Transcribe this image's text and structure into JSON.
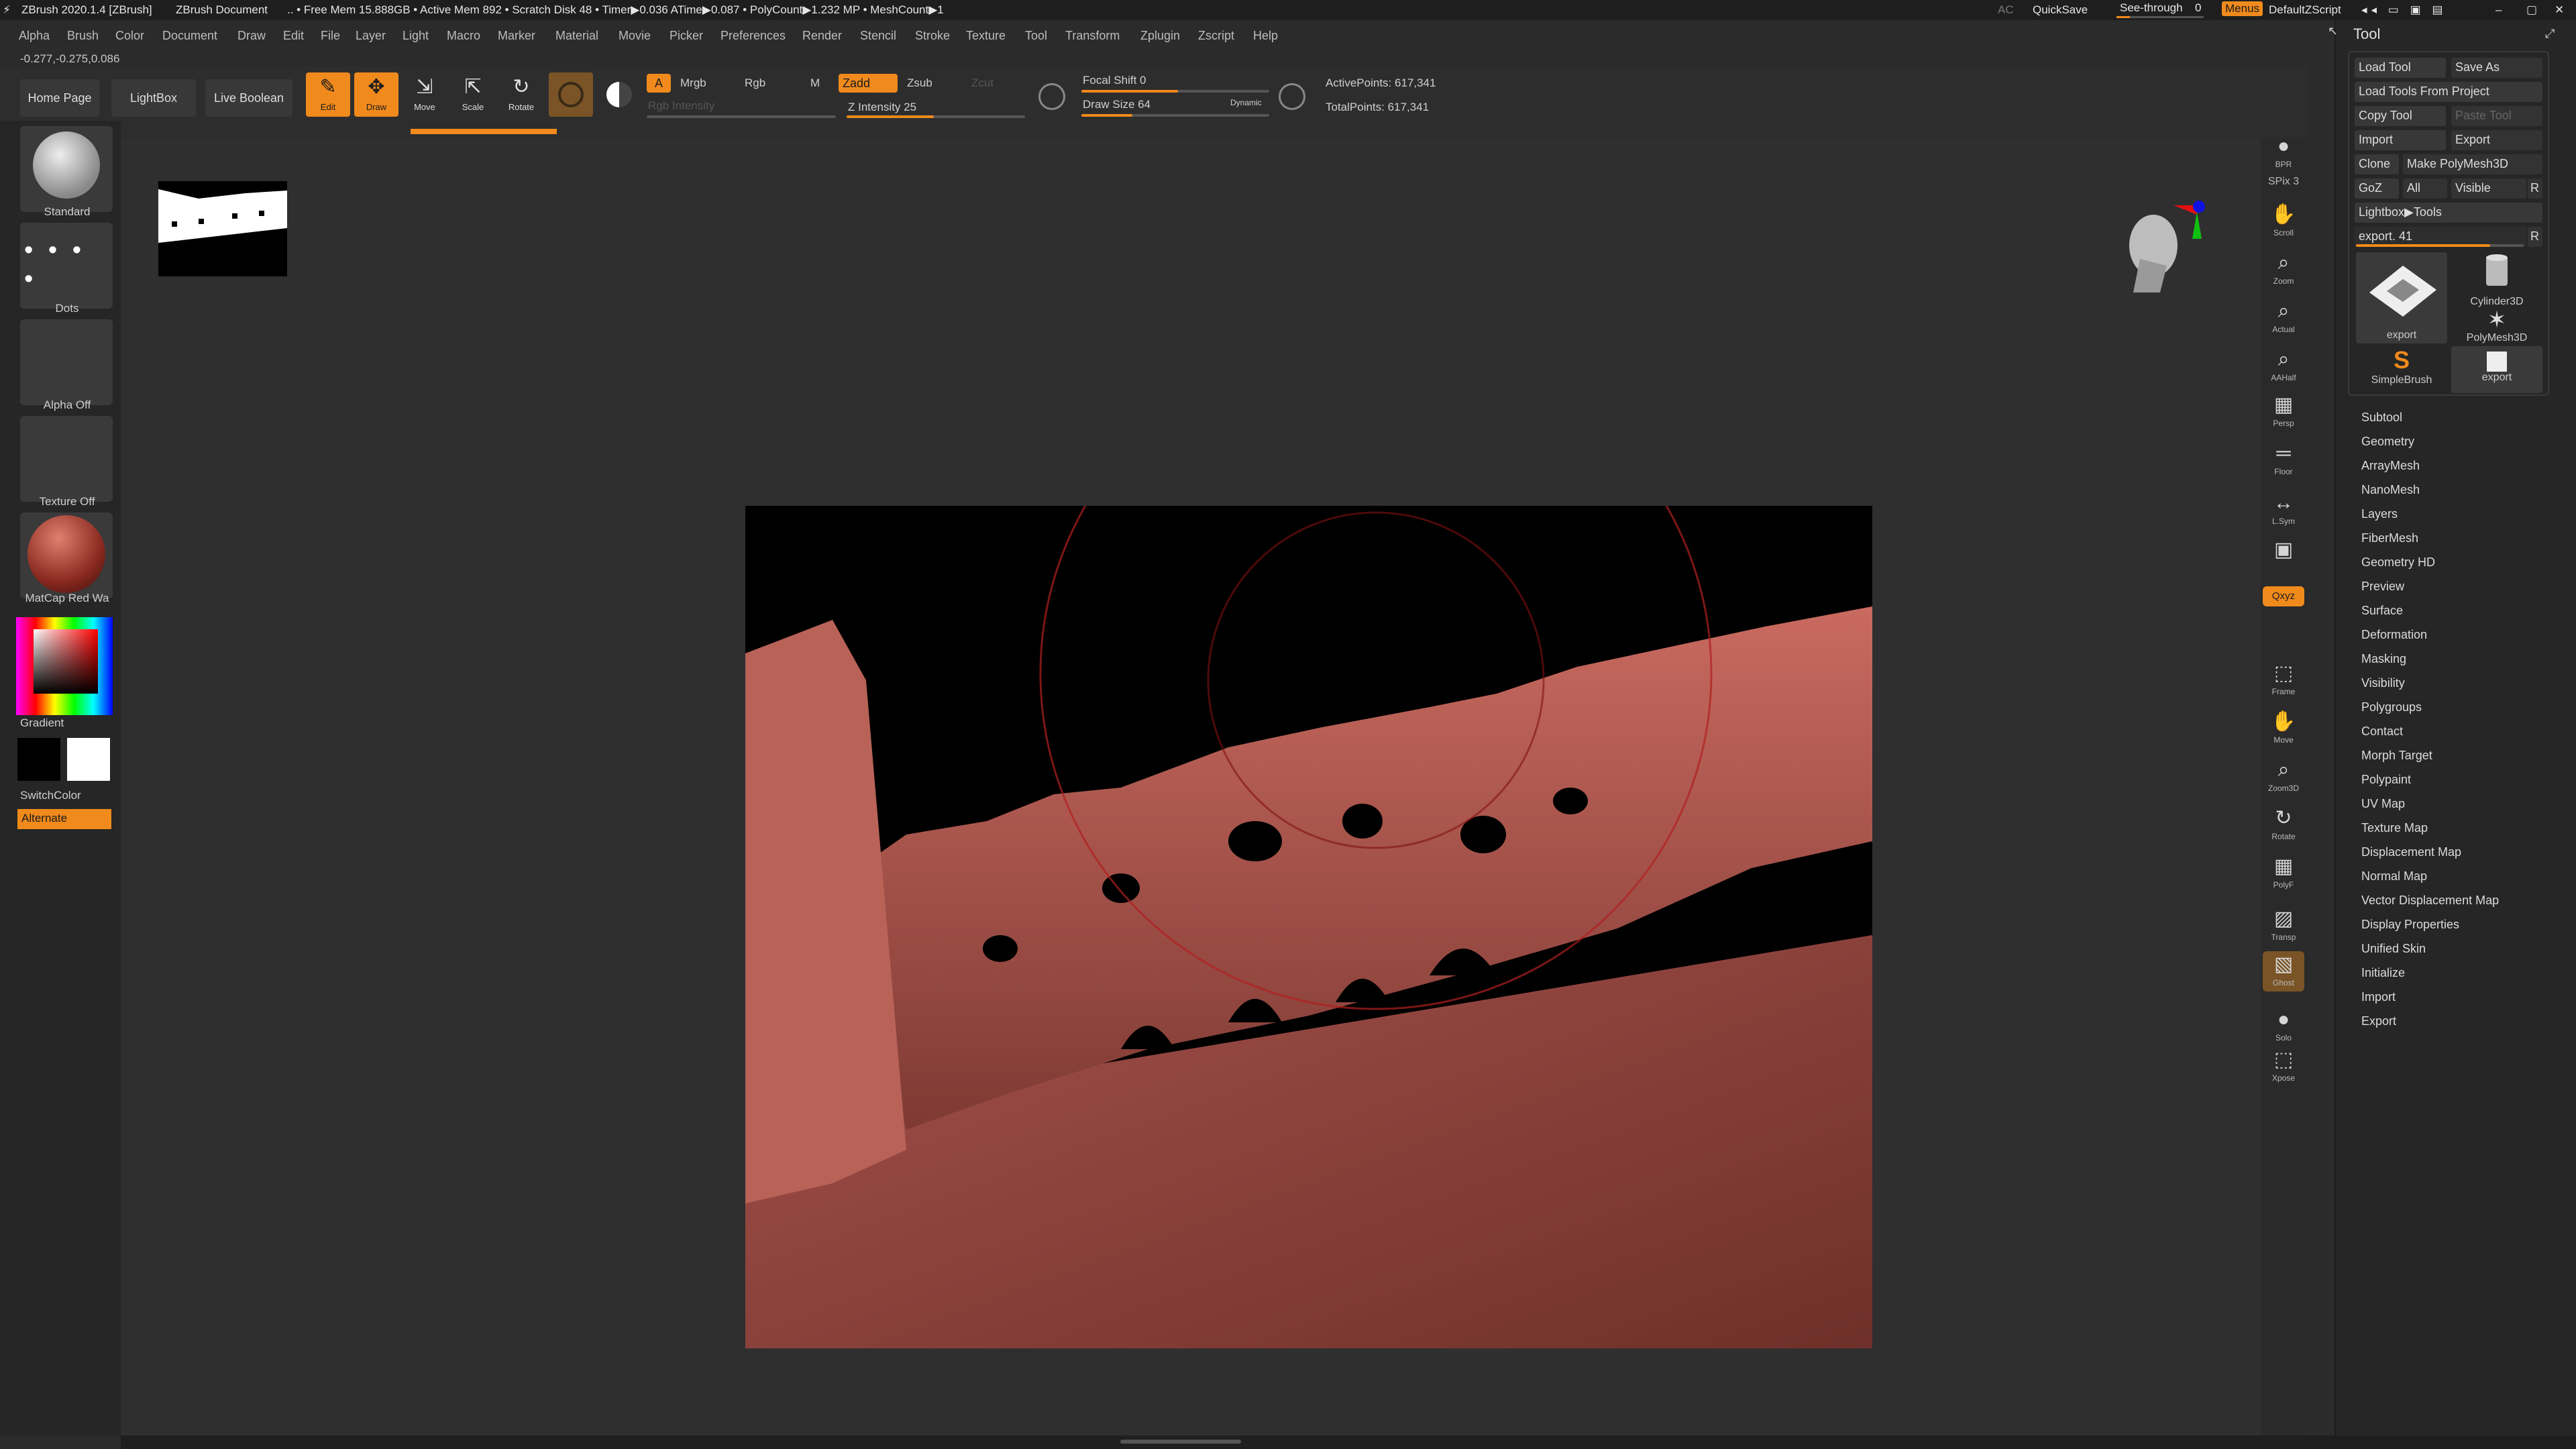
{
  "title_bar": {
    "app": "ZBrush 2020.1.4 [ZBrush]",
    "document": "ZBrush Document",
    "stats": ".. • Free Mem 15.888GB • Active Mem 892 • Scratch Disk 48 • Timer▶0.036 ATime▶0.087 • PolyCount▶1.232 MP • MeshCount▶1",
    "ac": "AC",
    "quicksave": "QuickSave",
    "see_through": "See-through",
    "see_through_value": "0",
    "menus": "Menus",
    "zscript": "DefaultZScript"
  },
  "menu_bar": [
    "Alpha",
    "Brush",
    "Color",
    "Document",
    "Draw",
    "Edit",
    "File",
    "Layer",
    "Light",
    "Macro",
    "Marker",
    "Material",
    "Movie",
    "Picker",
    "Preferences",
    "Render",
    "Stencil",
    "Stroke",
    "Texture",
    "Tool",
    "Transform",
    "Zplugin",
    "Zscript",
    "Help"
  ],
  "coords": "-0.277,-0.275,0.086",
  "top_shelf": {
    "home_page": "Home Page",
    "lightbox": "LightBox",
    "live_boolean": "Live Boolean",
    "edit": "Edit",
    "draw": "Draw",
    "move": "Move",
    "scale": "Scale",
    "rotate": "Rotate",
    "a": "A",
    "mrgb": "Mrgb",
    "rgb": "Rgb",
    "m": "M",
    "rgb_intensity": "Rgb Intensity",
    "zadd": "Zadd",
    "zsub": "Zsub",
    "zcut": "Zcut",
    "z_intensity": "Z Intensity 25",
    "focal_shift": "Focal Shift 0",
    "draw_size": "Draw Size 64",
    "dynamic": "Dynamic",
    "active_points": "ActivePoints: 617,341",
    "total_points": "TotalPoints: 617,341"
  },
  "left_panel": {
    "brush": "Standard",
    "stroke": "Dots",
    "alpha": "Alpha Off",
    "texture": "Texture Off",
    "material": "MatCap Red Wa",
    "gradient": "Gradient",
    "switch_color": "SwitchColor",
    "alternate": "Alternate"
  },
  "right_shelf": [
    {
      "name": "bpr",
      "label": "BPR",
      "glyph": "●"
    },
    {
      "name": "spix",
      "label": "SPix 3",
      "glyph": ""
    },
    {
      "name": "scroll",
      "label": "Scroll",
      "glyph": "✋"
    },
    {
      "name": "zoom",
      "label": "Zoom",
      "glyph": "⌕"
    },
    {
      "name": "actual",
      "label": "Actual",
      "glyph": "⌕"
    },
    {
      "name": "aahalf",
      "label": "AAHalf",
      "glyph": "⌕"
    },
    {
      "name": "persp",
      "label": "Persp",
      "glyph": "▦"
    },
    {
      "name": "floor",
      "label": "Floor",
      "glyph": "═"
    },
    {
      "name": "lsym",
      "label": "L.Sym",
      "glyph": "↔"
    },
    {
      "name": "lock",
      "label": "",
      "glyph": "▣"
    },
    {
      "name": "xyz",
      "label": "Qxyz",
      "glyph": ""
    },
    {
      "name": "frame",
      "label": "Frame",
      "glyph": "⬚"
    },
    {
      "name": "move",
      "label": "Move",
      "glyph": "✋"
    },
    {
      "name": "zoom3d",
      "label": "Zoom3D",
      "glyph": "⌕"
    },
    {
      "name": "rotate",
      "label": "Rotate",
      "glyph": "↻"
    },
    {
      "name": "polyf",
      "label": "PolyF",
      "glyph": "▦"
    },
    {
      "name": "transp",
      "label": "Transp",
      "glyph": "▨"
    },
    {
      "name": "ghost",
      "label": "Ghost",
      "glyph": "▧"
    },
    {
      "name": "solo",
      "label": "Solo",
      "glyph": "●"
    },
    {
      "name": "xpose",
      "label": "Xpose",
      "glyph": "⬚"
    }
  ],
  "tool_panel": {
    "header": "Tool",
    "load_tool": "Load Tool",
    "save_as": "Save As",
    "load_from_project": "Load Tools From Project",
    "copy_tool": "Copy Tool",
    "paste_tool": "Paste Tool",
    "import": "Import",
    "export": "Export",
    "clone": "Clone",
    "make_polymesh": "Make PolyMesh3D",
    "goz": "GoZ",
    "all": "All",
    "visible": "Visible",
    "r": "R",
    "lightbox_tools": "Lightbox▶Tools",
    "export_slider": "export. 41",
    "thumbs": [
      "export",
      "Cylinder3D",
      "PolyMesh3D",
      "SimpleBrush",
      "export"
    ],
    "menu": [
      "Subtool",
      "Geometry",
      "ArrayMesh",
      "NanoMesh",
      "Layers",
      "FiberMesh",
      "Geometry HD",
      "Preview",
      "Surface",
      "Deformation",
      "Masking",
      "Visibility",
      "Polygroups",
      "Contact",
      "Morph Target",
      "Polypaint",
      "UV Map",
      "Texture Map",
      "Displacement Map",
      "Normal Map",
      "Vector Displacement Map",
      "Display Properties",
      "Unified Skin",
      "Initialize",
      "Import",
      "Export"
    ]
  },
  "colors": {
    "accent": "#f08a1c",
    "clay": "#b85a50",
    "bg": "#2f2f2f"
  }
}
